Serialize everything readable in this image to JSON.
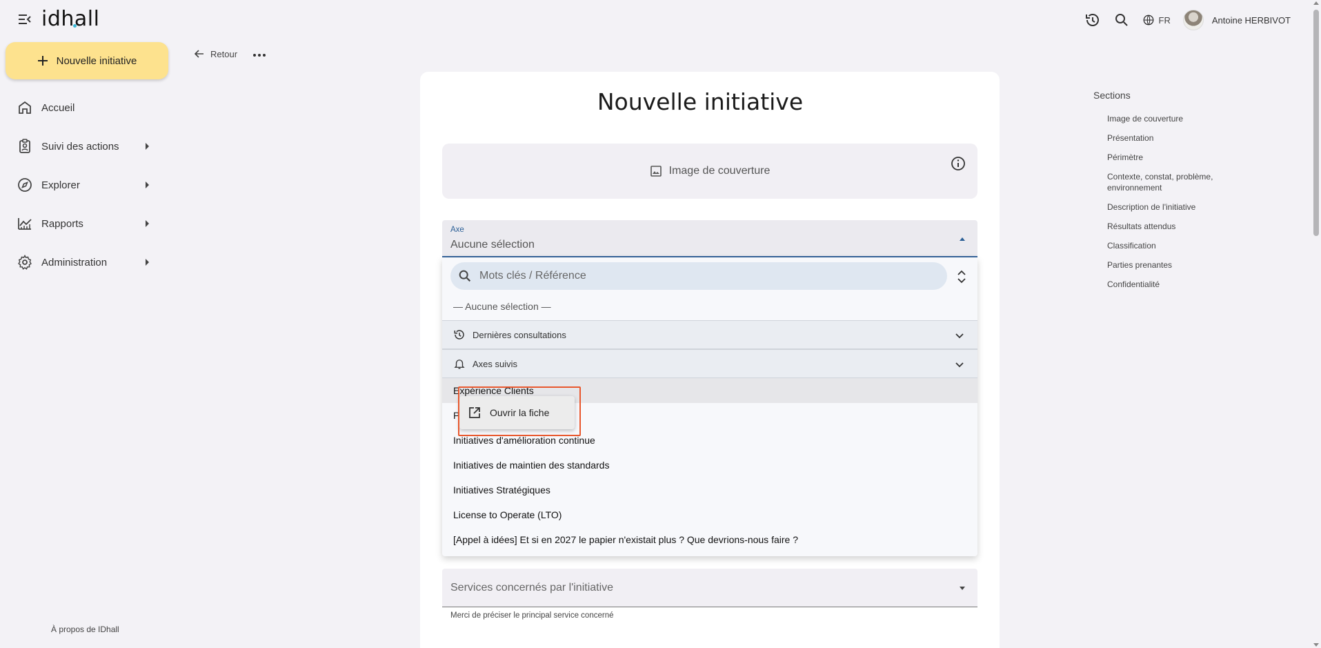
{
  "app": {
    "logo": "idhall"
  },
  "header": {
    "language": "FR",
    "user_name": "Antoine HERBIVOT",
    "icons": [
      "history-icon",
      "search-icon",
      "globe-icon"
    ]
  },
  "sidebar": {
    "new_button": "Nouvelle initiative",
    "items": [
      {
        "label": "Accueil",
        "icon": "home-icon",
        "has_submenu": false
      },
      {
        "label": "Suivi des actions",
        "icon": "clipboard-user-icon",
        "has_submenu": true
      },
      {
        "label": "Explorer",
        "icon": "compass-icon",
        "has_submenu": true
      },
      {
        "label": "Rapports",
        "icon": "chart-icon",
        "has_submenu": true
      },
      {
        "label": "Administration",
        "icon": "gear-icon",
        "has_submenu": true
      }
    ],
    "about": "À propos de IDhall"
  },
  "toolbar": {
    "back_label": "Retour"
  },
  "form": {
    "title": "Nouvelle initiative",
    "cover_label": "Image de couverture",
    "axe": {
      "label": "Axe",
      "value": "Aucune sélection"
    },
    "dropdown": {
      "search_placeholder": "Mots clés / Référence",
      "none_option": "— Aucune sélection —",
      "groups": [
        {
          "label": "Dernières consultations",
          "icon": "history-icon"
        },
        {
          "label": "Axes suivis",
          "icon": "bell-icon"
        }
      ],
      "options": [
        "Expérience Clients",
        "P",
        "Initiatives d'amélioration continue",
        "Initiatives de maintien des standards",
        "Initiatives Stratégiques",
        "License to Operate (LTO)",
        "[Appel à idées] Et si en 2027 le papier n'existait plus ? Que devrions-nous faire ?"
      ]
    },
    "context_menu": {
      "label": "Ouvrir la fiche",
      "icon": "open-external-icon"
    },
    "services": {
      "placeholder": "Services concernés par l'initiative",
      "helper": "Merci de préciser le principal service concerné"
    }
  },
  "sections": {
    "title": "Sections",
    "items": [
      "Image de couverture",
      "Présentation",
      "Périmètre",
      "Contexte, constat, problème, environnement",
      "Description de l'initiative",
      "Résultats attendus",
      "Classification",
      "Parties prenantes",
      "Confidentialité"
    ]
  },
  "colors": {
    "primary_button": "#fde28e",
    "accent": "#2b5f96",
    "highlight_frame": "#e8572d",
    "logo_dot": "#3ab7d6"
  }
}
